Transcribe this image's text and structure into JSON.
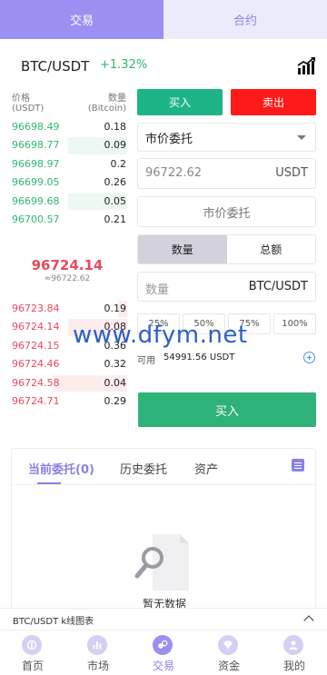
{
  "top_tabs": {
    "spot": "交易",
    "contract": "合约"
  },
  "pair": {
    "name": "BTC/USDT",
    "change": "+1.32%"
  },
  "book": {
    "head_left_1": "价格",
    "head_left_2": "(USDT)",
    "head_right_1": "数量",
    "head_right_2": "(Bitcoin)",
    "bids": [
      {
        "price": "96698.49",
        "qty": "0.18",
        "depth": 0
      },
      {
        "price": "96698.77",
        "qty": "0.09",
        "depth": 0.5
      },
      {
        "price": "96698.97",
        "qty": "0.2",
        "depth": 0
      },
      {
        "price": "96699.05",
        "qty": "0.26",
        "depth": 0
      },
      {
        "price": "96699.68",
        "qty": "0.05",
        "depth": 0.5
      },
      {
        "price": "96700.57",
        "qty": "0.21",
        "depth": 0
      }
    ],
    "mid_price": "96724.14",
    "mid_sub": "≈96722.62",
    "asks": [
      {
        "price": "96723.84",
        "qty": "0.19",
        "depth": 0.08
      },
      {
        "price": "96724.14",
        "qty": "0.08",
        "depth": 0.5
      },
      {
        "price": "96724.15",
        "qty": "0.36",
        "depth": 0
      },
      {
        "price": "96724.46",
        "qty": "0.32",
        "depth": 0
      },
      {
        "price": "96724.58",
        "qty": "0.04",
        "depth": 0.62
      },
      {
        "price": "96724.71",
        "qty": "0.29",
        "depth": 0
      }
    ]
  },
  "form": {
    "buy_label": "买入",
    "sell_label": "卖出",
    "order_type": "市价委托",
    "price_value": "96722.62",
    "price_unit": "USDT",
    "market_label": "市价委托",
    "mode_qty": "数量",
    "mode_total": "总额",
    "qty_placeholder": "数量",
    "qty_unit": "BTC/USDT",
    "pcts": [
      "25%",
      "50%",
      "75%",
      "100%"
    ],
    "available_label": "可用",
    "available_amount": "54991.56 USDT",
    "submit_label": "买入"
  },
  "watermark": "www.dfym.net",
  "orders": {
    "tab_current": "当前委托(0)",
    "tab_history": "历史委托",
    "tab_assets": "资产",
    "empty_text": "暂无数据"
  },
  "kline_bar": {
    "label": "BTC/USDT k线图表"
  },
  "nav": [
    {
      "label": "首页",
      "icon": "home-icon"
    },
    {
      "label": "市场",
      "icon": "market-icon"
    },
    {
      "label": "交易",
      "icon": "trade-icon",
      "active": true
    },
    {
      "label": "资金",
      "icon": "funds-icon"
    },
    {
      "label": "我的",
      "icon": "profile-icon"
    }
  ],
  "colors": {
    "accent": "#9b8ff2",
    "buy": "#1fb38a",
    "sell": "#ff1a1a",
    "bid_text": "#2eb872",
    "ask_text": "#e84a5f"
  }
}
